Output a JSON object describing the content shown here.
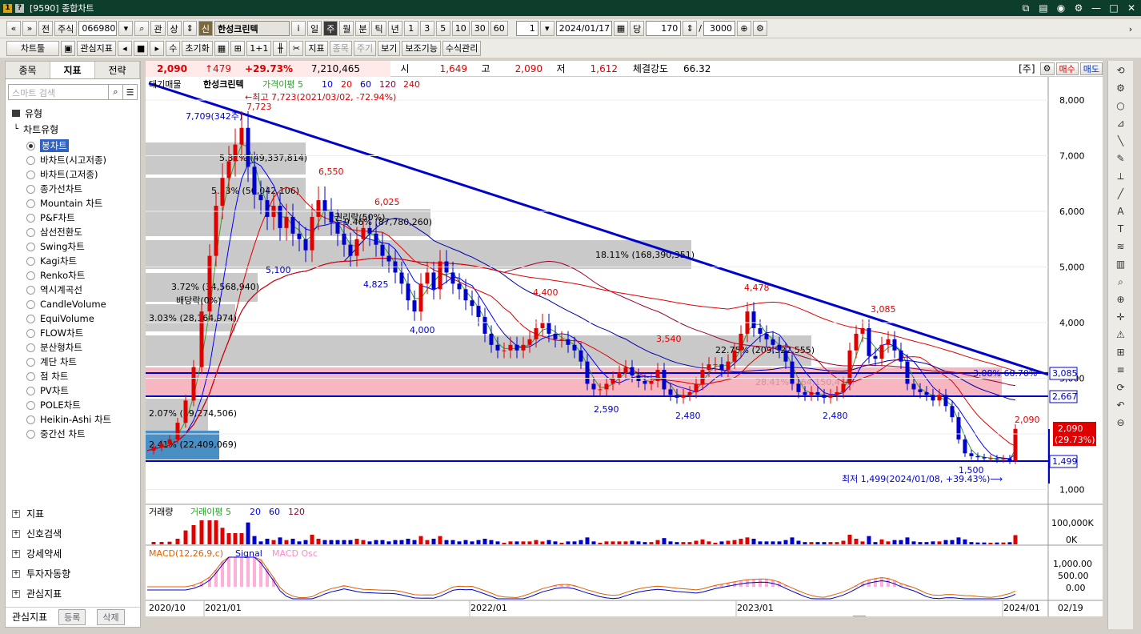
{
  "window": {
    "title": "[9590] 종합차트",
    "icons": [
      "help-icon",
      "info-icon"
    ]
  },
  "toolbar1": {
    "nav_first": "«",
    "nav_up": "»",
    "prev": "전",
    "market": "주식",
    "code": "066980",
    "search_icon": "⌕",
    "kwan": "관",
    "sang": "상",
    "sin_badge": "신",
    "stock_name": "한성크린텍",
    "info": "i",
    "periods": [
      "일",
      "주",
      "월",
      "분",
      "틱",
      "년"
    ],
    "active_period": "주",
    "minutes": [
      "1",
      "3",
      "5",
      "10",
      "30",
      "60"
    ],
    "unit_value": "1",
    "date": "2024/01/17",
    "count_label": "당",
    "count": "170",
    "slash": "/",
    "total": "3000"
  },
  "toolbar2": {
    "chart_tool": "차트툴",
    "watch_indicator": "관심지표",
    "su": "수",
    "reset": "초기화",
    "indicator": "지표",
    "stock": "종목",
    "cycle": "주기",
    "view": "보기",
    "aux": "보조기능",
    "formula": "수식관리"
  },
  "left": {
    "tabs": [
      "종목",
      "지표",
      "전략"
    ],
    "active_tab": "지표",
    "search_placeholder": "스마트 검색",
    "section_type": "유형",
    "tree_root": "차트유형",
    "chart_types": [
      "봉차트",
      "바차트(시고저종)",
      "바차트(고저종)",
      "종가선차트",
      "Mountain 차트",
      "P&F차트",
      "삼선전환도",
      "Swing차트",
      "Kagi차트",
      "Renko차트",
      "역시계곡선",
      "CandleVolume",
      "EquiVolume",
      "FLOW차트",
      "분산형차트",
      "계단 차트",
      "점 차트",
      "PV차트",
      "POLE차트",
      "Heikin-Ashi 차트",
      "중간선 차트"
    ],
    "selected_type": "봉차트",
    "groups": [
      "지표",
      "신호검색",
      "강세약세",
      "투자자동향",
      "관심지표"
    ],
    "footer_label": "관심지표",
    "footer_register": "등록",
    "footer_delete": "삭제"
  },
  "quote": {
    "price": "2,090",
    "change": "↑479",
    "rate": "+29.73%",
    "volume": "7,210,465",
    "open_label": "시",
    "open": "1,649",
    "high_label": "고",
    "high": "2,090",
    "low_label": "저",
    "low": "1,612",
    "strength_label": "체결강도",
    "strength": "66.32",
    "stock_badge": "[주]",
    "buy": "매수",
    "sell": "매도"
  },
  "price_chart": {
    "legend_supply": "대기매물",
    "legend_name": "한성크린텍",
    "legend_ma": "가격이평 5",
    "legend_periods": [
      "10",
      "20",
      "60",
      "120",
      "240"
    ],
    "legend_colors": [
      "#2aa12a",
      "#0000ff",
      "#e00000",
      "#0000aa",
      "#990033",
      "#e00000"
    ],
    "y_ticks": [
      "8,000",
      "7,000",
      "6,000",
      "5,000",
      "4,000",
      "3,000",
      "2,000",
      "1,000"
    ],
    "high_note": "←최고 7,723(2021/03/02, -72.94%)",
    "low_note": "최저 1,499(2024/01/08, +39.43%)⟶",
    "last_price_tag": "2,090",
    "last_rate_tag": "(29.73%)",
    "line_tags": [
      "3,085",
      "2,667",
      "1,499"
    ],
    "supply_bands": [
      "5.31% (49,337,814)",
      "5.33% (50,042,106)",
      "9.46% (87,780,260)",
      "18.11% (168,390,351)",
      "3.72% (34,568,940)",
      "3.03% (28,164,974)",
      "22.75% (209,522,555)",
      "28.41% (264,150,470)",
      "2.07% (19,274,506)",
      "2.41% (22,409,069)"
    ],
    "annotations": [
      "7,709(342주)",
      "7,723",
      "6,550",
      "6,025",
      "권리락(50%)",
      "5,100",
      "4,825",
      "4,000",
      "4,400",
      "배당락(0%)",
      "3,540",
      "4,478",
      "3,085",
      "2,590",
      "2,480",
      "2,480",
      "1,500",
      "2,090",
      "3.08% 60.70%"
    ]
  },
  "volume_chart": {
    "legend_name": "거래량",
    "legend_ma": "거래이평 5",
    "legend_periods": [
      "20",
      "60",
      "120"
    ],
    "y_ticks": [
      "100,000K",
      "0K"
    ]
  },
  "macd_chart": {
    "legend_macd": "MACD(12,26,9,c)",
    "legend_signal": "Signal",
    "legend_osc": "MACD Osc",
    "y_ticks": [
      "1,000.00",
      "500.00",
      "0.00"
    ]
  },
  "x_axis": {
    "labels": [
      "2020/10",
      "2021/01",
      "2022/01",
      "2023/01",
      "2024/01",
      "02/19"
    ]
  },
  "right_tools": [
    "rotate-icon",
    "gear-icon",
    "circle-icon",
    "chart-icon",
    "line-icon",
    "pen-icon",
    "ruler-icon",
    "slash-icon",
    "auto-icon",
    "text-icon",
    "fib-icon",
    "bars-icon",
    "zoom-icon",
    "magnify-icon",
    "cross-icon",
    "alert-icon",
    "grid-icon",
    "lines-icon",
    "refresh-icon",
    "undo-icon",
    "zoom-out-icon"
  ]
}
